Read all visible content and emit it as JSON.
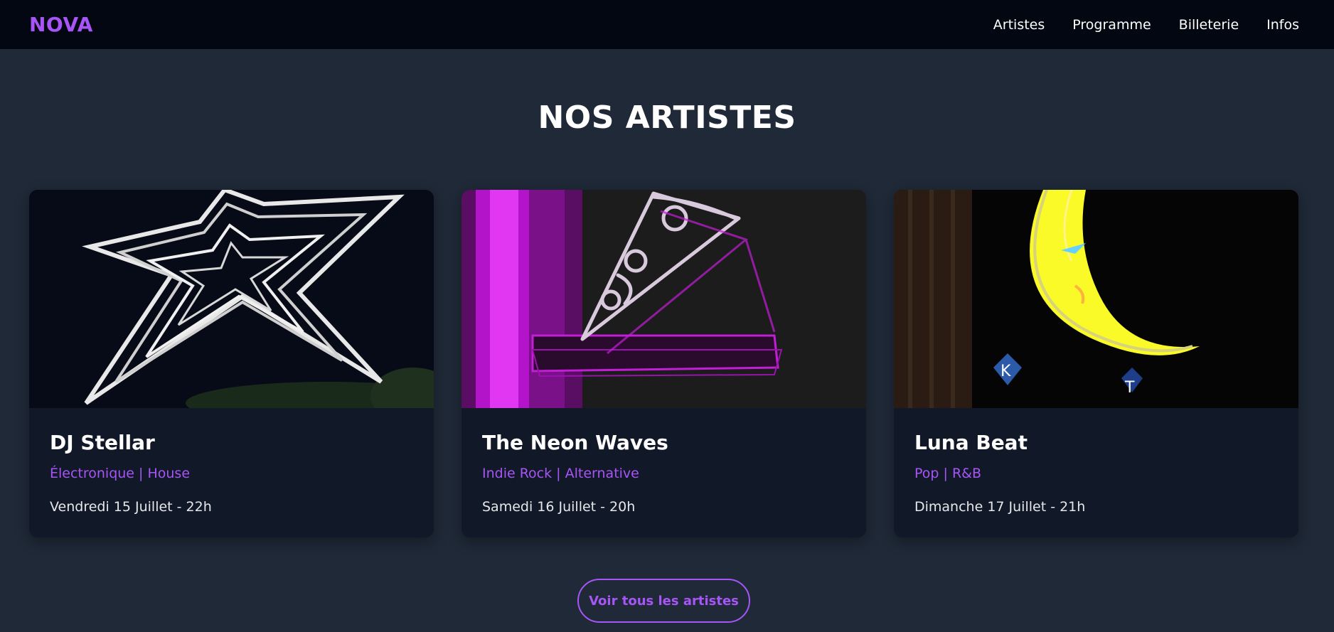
{
  "header": {
    "logo": "NOVA",
    "nav": [
      "Artistes",
      "Programme",
      "Billeterie",
      "Infos"
    ]
  },
  "section": {
    "title": "NOS ARTISTES"
  },
  "artists": [
    {
      "name": "DJ Stellar",
      "genre": "Électronique | House",
      "date": "Vendredi 15 Juillet - 22h",
      "image": "neon-star-image"
    },
    {
      "name": "The Neon Waves",
      "genre": "Indie Rock | Alternative",
      "date": "Samedi 16 Juillet - 20h",
      "image": "neon-pizza-image"
    },
    {
      "name": "Luna Beat",
      "genre": "Pop | R&B",
      "date": "Dimanche 17 Juillet - 21h",
      "image": "neon-moon-image"
    }
  ],
  "cta": {
    "label": "Voir tous les artistes"
  },
  "colors": {
    "accent": "#a855f7",
    "page_bg": "#1f2937",
    "header_bg": "#030712",
    "card_bg": "#111827"
  }
}
